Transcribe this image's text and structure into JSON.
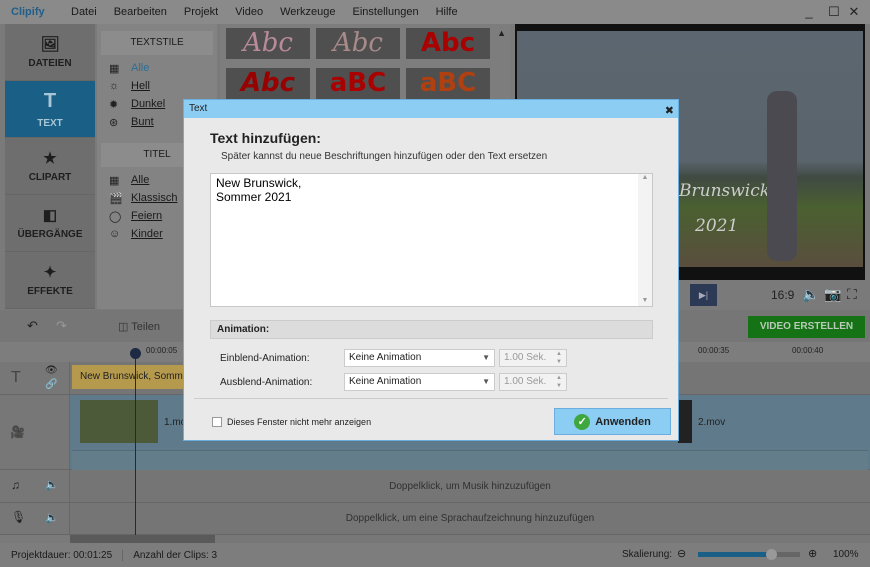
{
  "app": {
    "title": "Clipify",
    "menu": [
      "Datei",
      "Bearbeiten",
      "Projekt",
      "Video",
      "Werkzeuge",
      "Einstellungen",
      "Hilfe"
    ]
  },
  "sidebar": {
    "items": [
      {
        "label": "DATEIEN",
        "icon": "image-icon"
      },
      {
        "label": "TEXT",
        "icon": "text-icon",
        "active": true
      },
      {
        "label": "CLIPART",
        "icon": "star-icon"
      },
      {
        "label": "ÜBERGÄNGE",
        "icon": "transitions-icon"
      },
      {
        "label": "EFFEKTE",
        "icon": "magic-wand-icon"
      }
    ]
  },
  "panel": {
    "textstile_header": "TEXTSTILE",
    "textstile": [
      "Alle",
      "Hell",
      "Dunkel",
      "Bunt"
    ],
    "titel_header": "TITEL",
    "titel": [
      "Alle",
      "Klassisch",
      "Feiern",
      "Kinder"
    ]
  },
  "thumbs": [
    "Abc",
    "Abc",
    "Abc",
    "Abc",
    "aBC",
    "aBC"
  ],
  "preview": {
    "overlay_line1": "Brunswick,",
    "overlay_line2": "2021",
    "aspect": "16:9"
  },
  "toolbar": {
    "split": "Teilen",
    "create_video": "VIDEO ERSTELLEN"
  },
  "ruler": {
    "ticks": [
      "00:00:05",
      "00:00:35",
      "00:00:40"
    ]
  },
  "timeline": {
    "text_clip": "New Brunswick,  Sommer 2021",
    "clip1": "1.mov",
    "clip2": "2.mov",
    "music_hint": "Doppelklick, um Musik hinzuzufügen",
    "voice_hint": "Doppelklick, um eine Sprachaufzeichnung hinzuzufügen"
  },
  "status": {
    "duration": "Projektdauer:  00:01:25",
    "clips": "Anzahl der Clips: 3",
    "scale_label": "Skalierung:",
    "scale_value": "100%",
    "scale_fraction": 0.72
  },
  "dialog": {
    "title": "Text",
    "heading": "Text hinzufügen:",
    "subtitle": "Später kannst du neue Beschriftungen hinzufügen oder den Text ersetzen",
    "text": "New Brunswick,\nSommer 2021",
    "animation_header": "Animation:",
    "in_label": "Einblend-Animation:",
    "in_value": "Keine Animation",
    "in_duration": "1.00 Sek.",
    "out_label": "Ausblend-Animation:",
    "out_value": "Keine Animation",
    "out_duration": "1.00 Sek.",
    "checkbox": "Dieses Fenster nicht mehr anzeigen",
    "apply": "Anwenden"
  },
  "colors": {
    "accent": "#1a5f85",
    "create": "#157215",
    "dialog_title": "#8ccdf3"
  }
}
